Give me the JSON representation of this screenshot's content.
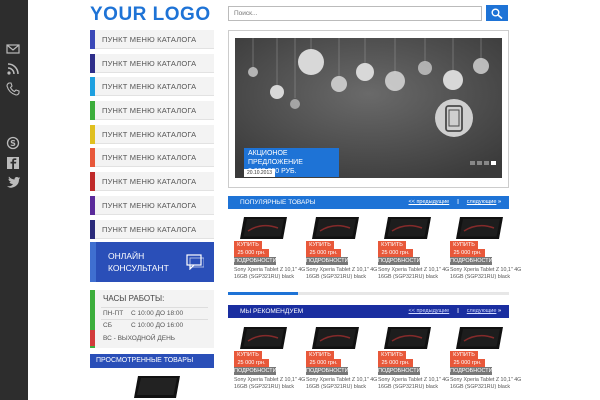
{
  "logo": "YOUR LOGO",
  "search": {
    "placeholder": "Поиск..."
  },
  "menu": [
    {
      "label": "ПУНКТ МЕНЮ КАТАЛОГА",
      "color": "#3a48b8"
    },
    {
      "label": "ПУНКТ МЕНЮ КАТАЛОГА",
      "color": "#2e2e8a"
    },
    {
      "label": "ПУНКТ МЕНЮ КАТАЛОГА",
      "color": "#1ea0e0"
    },
    {
      "label": "ПУНКТ МЕНЮ КАТАЛОГА",
      "color": "#3cae3c"
    },
    {
      "label": "ПУНКТ МЕНЮ КАТАЛОГА",
      "color": "#e0c020"
    },
    {
      "label": "ПУНКТ МЕНЮ КАТАЛОГА",
      "color": "#e8583a"
    },
    {
      "label": "ПУНКТ МЕНЮ КАТАЛОГА",
      "color": "#c02a2a"
    },
    {
      "label": "ПУНКТ МЕНЮ КАТАЛОГА",
      "color": "#5a2a9a"
    },
    {
      "label": "ПУНКТ МЕНЮ КАТАЛОГА",
      "color": "#2a2a7a"
    }
  ],
  "consult": {
    "line1": "ОНЛАЙН",
    "line2": "КОНСУЛЬТАНТ"
  },
  "hours": {
    "title": "ЧАСЫ РАБОТЫ:",
    "rows": [
      {
        "day": "ПН-ПТ",
        "time": "С 10:00 ДО 18:00"
      },
      {
        "day": "СБ",
        "time": "С 10:00 ДО 16:00"
      }
    ],
    "weekend": "ВС - ВЫХОДНОЙ ДЕНЬ"
  },
  "viewed": "ПРОСМОТРЕННЫЕ ТОВАРЫ",
  "banner": {
    "promo_line1": "АКЦИОНОЕ ПРЕДЛОЖЕНИЕ",
    "promo_line2": "2 000 000 РУБ.",
    "date": "20.10.2013"
  },
  "sections": [
    {
      "title": "ПОПУЛЯРНЫЕ ТОВАРЫ",
      "prev": "<< предыдущие",
      "next": "следующие",
      "progress": 0.25
    },
    {
      "title": "МЫ РЕКОМЕНДУЕМ",
      "prev": "<< предыдущие",
      "next": "следующие",
      "progress": 0.25
    }
  ],
  "product": {
    "buy": "КУПИТЬ",
    "price": "25 000 грн.",
    "details": "ПОДРОБНОСТИ",
    "name": "Sony Xperia Tablet Z 10,1\" 4G 16GB (SGP321RU) black"
  },
  "colors": {
    "accent": "#1e73d6",
    "sale": "#e8583a",
    "dark_rail": "#2d2d2d"
  }
}
